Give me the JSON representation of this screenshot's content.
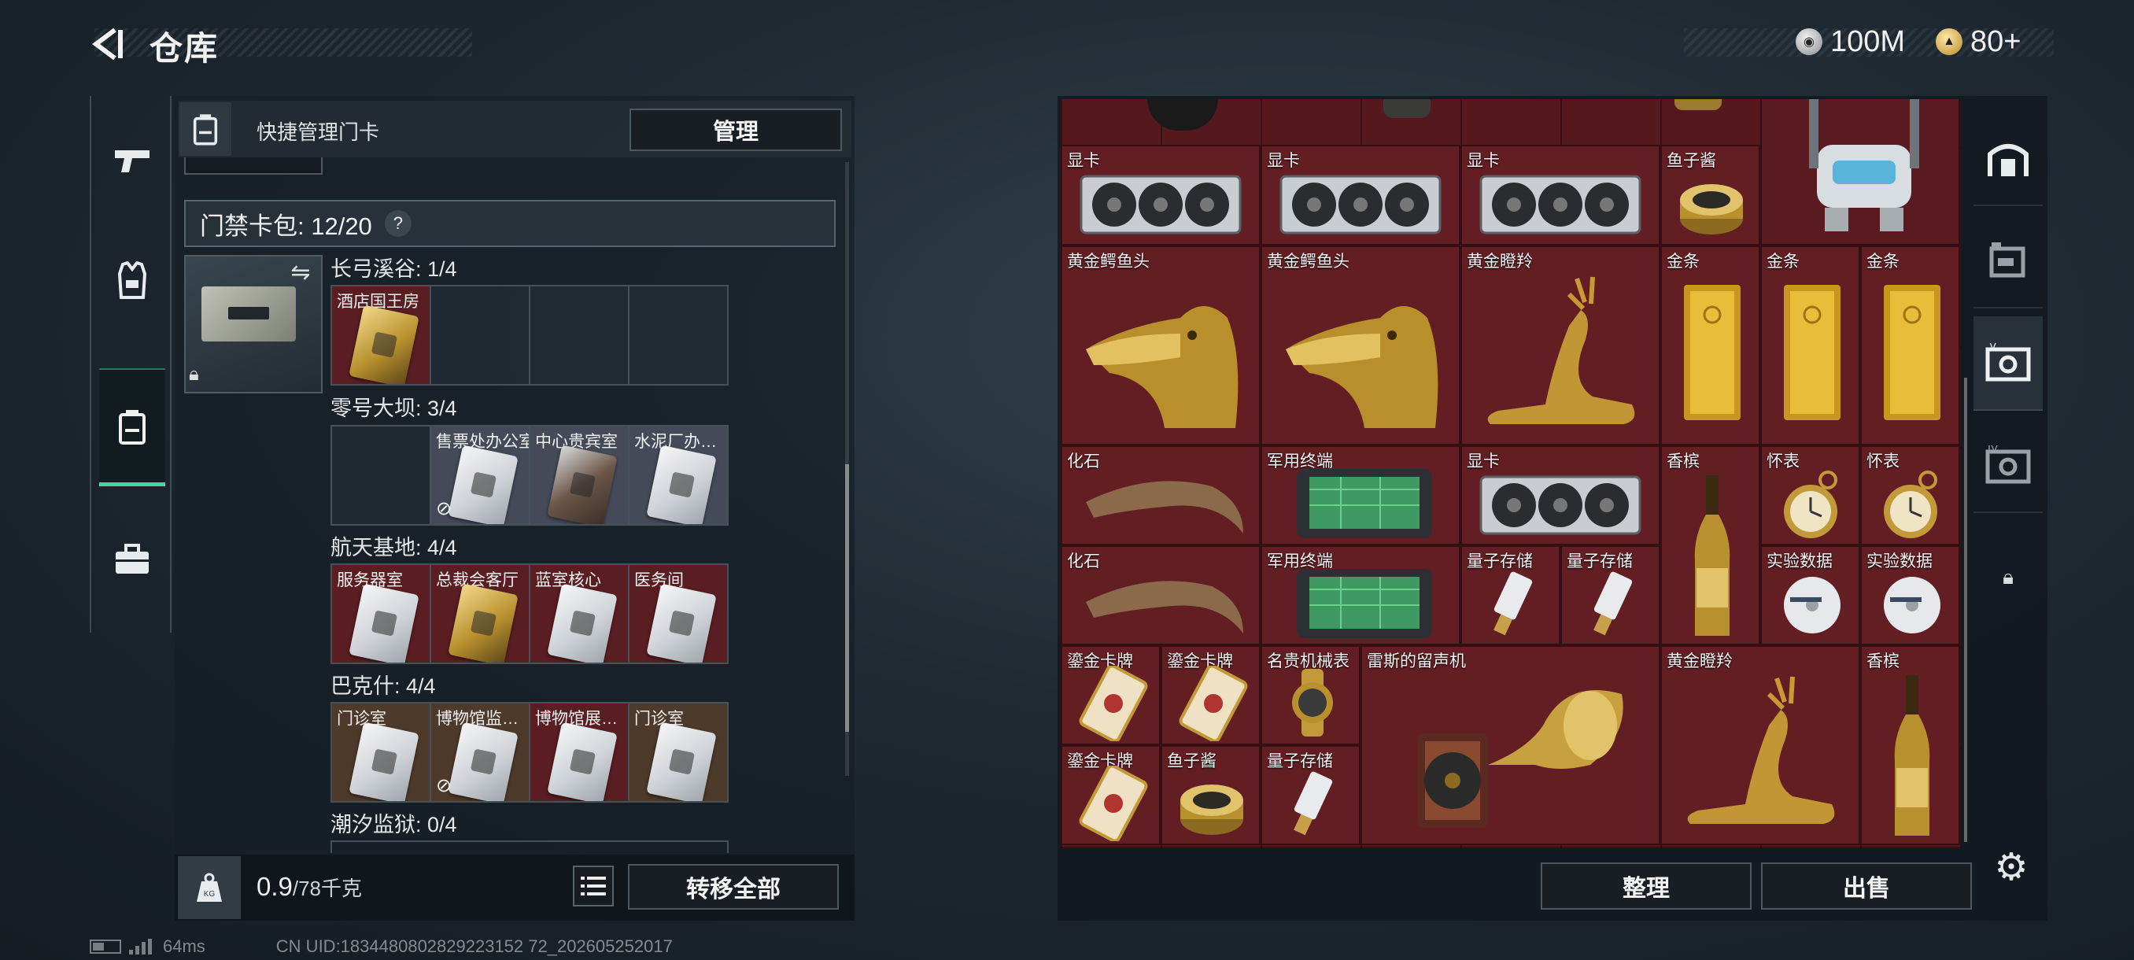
{
  "header": {
    "title": "仓库",
    "currency_silver": "100M",
    "currency_gold": "80+"
  },
  "keycard_panel": {
    "header_label": "快捷管理门卡",
    "manage_label": "管理",
    "card_pack_label": "门禁卡包: 12/20",
    "help_symbol": "?",
    "regions": [
      {
        "title": "长弓溪谷: 1/4",
        "slots": [
          {
            "label": "酒店国王房",
            "card": "gold",
            "bg": "red"
          },
          null,
          null,
          null
        ]
      },
      {
        "title": "零号大坝: 3/4",
        "slots": [
          null,
          {
            "label": "售票处办公室",
            "card": "silver",
            "bg": "gray",
            "no_transfer": true
          },
          {
            "label": "中心贵宾室",
            "card": "dark",
            "bg": "gray"
          },
          {
            "label": "水泥厂办…",
            "card": "silver",
            "bg": "gray"
          }
        ]
      },
      {
        "title": "航天基地: 4/4",
        "slots": [
          {
            "label": "服务器室",
            "card": "silver",
            "bg": "red"
          },
          {
            "label": "总裁会客厅",
            "card": "gold",
            "bg": "red"
          },
          {
            "label": "蓝室核心",
            "card": "silver",
            "bg": "red"
          },
          {
            "label": "医务间",
            "card": "silver",
            "bg": "red"
          }
        ]
      },
      {
        "title": "巴克什: 4/4",
        "slots": [
          {
            "label": "门诊室",
            "card": "silver",
            "bg": "brown"
          },
          {
            "label": "博物馆监…",
            "card": "silver",
            "bg": "brown",
            "no_transfer": true
          },
          {
            "label": "博物馆展…",
            "card": "silver",
            "bg": "red"
          },
          {
            "label": "门诊室",
            "card": "silver",
            "bg": "brown"
          }
        ]
      },
      {
        "title": "潮汐监狱: 0/4",
        "slots": []
      }
    ],
    "weight_value": "0.9",
    "weight_capacity": "/78千克",
    "transfer_all_label": "转移全部"
  },
  "stash": {
    "items": [
      {
        "label": "显卡",
        "art": "gpu"
      },
      {
        "label": "显卡",
        "art": "gpu"
      },
      {
        "label": "显卡",
        "art": "gpu"
      },
      {
        "label": "鱼子酱",
        "art": "caviar"
      },
      {
        "label": "",
        "art": "robot"
      },
      {
        "label": "黄金鳄鱼头",
        "art": "gold-head"
      },
      {
        "label": "黄金鳄鱼头",
        "art": "gold-head"
      },
      {
        "label": "黄金瞪羚",
        "art": "gazelle"
      },
      {
        "label": "金条",
        "art": "gold-bar"
      },
      {
        "label": "金条",
        "art": "gold-bar"
      },
      {
        "label": "金条",
        "art": "gold-bar"
      },
      {
        "label": "化石",
        "art": "fossil"
      },
      {
        "label": "军用终端",
        "art": "terminal"
      },
      {
        "label": "显卡",
        "art": "gpu"
      },
      {
        "label": "香槟",
        "art": "champagne"
      },
      {
        "label": "怀表",
        "art": "watch"
      },
      {
        "label": "怀表",
        "art": "watch"
      },
      {
        "label": "化石",
        "art": "fossil"
      },
      {
        "label": "军用终端",
        "art": "terminal"
      },
      {
        "label": "量子存储",
        "art": "usb"
      },
      {
        "label": "量子存储",
        "art": "usb"
      },
      {
        "label": "实验数据",
        "art": "disc"
      },
      {
        "label": "实验数据",
        "art": "disc"
      },
      {
        "label": "鎏金卡牌",
        "art": "card"
      },
      {
        "label": "鎏金卡牌",
        "art": "card"
      },
      {
        "label": "名贵机械表",
        "art": "wristwatch"
      },
      {
        "label": "雷斯的留声机",
        "art": "phonograph"
      },
      {
        "label": "黄金瞪羚",
        "art": "gazelle"
      },
      {
        "label": "香槟",
        "art": "champagne"
      },
      {
        "label": "鎏金卡牌",
        "art": "card"
      },
      {
        "label": "鱼子酱",
        "art": "caviar"
      },
      {
        "label": "量子存储",
        "art": "usb"
      }
    ],
    "sort_label": "整理",
    "sell_label": "出售"
  },
  "status_bar": {
    "ping": "64ms",
    "uid": "CN UID:1834480802829223152 72_202605252017"
  },
  "icons": {
    "back": "back-arrow-icon",
    "settings": "gear-icon",
    "left_nav": [
      "weapon-icon",
      "armor-vest-icon",
      "keycard-holder-icon",
      "briefcase-icon"
    ],
    "stash_nav": [
      "stash-home-icon",
      "stash-2-icon",
      "stash-3-icon",
      "stash-4-icon",
      "locked-stash-icon"
    ]
  }
}
